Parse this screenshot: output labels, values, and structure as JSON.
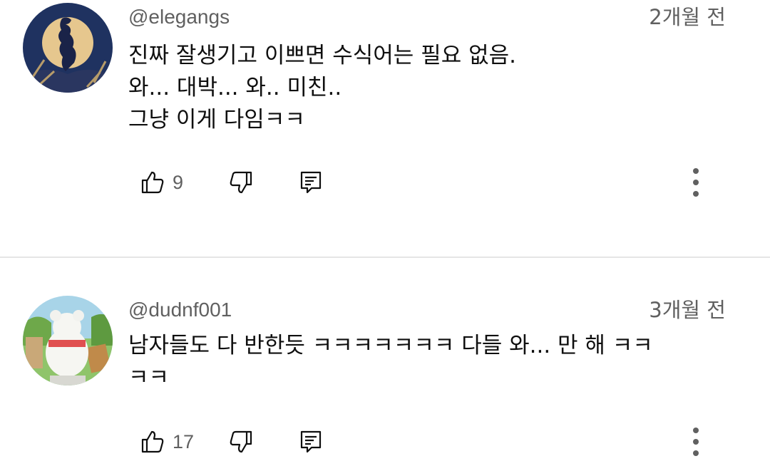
{
  "comments": [
    {
      "handle": "@elegangs",
      "time": "2개월 전",
      "lines": [
        "진짜 잘생기고 이쁘면 수식어는 필요 없음.",
        "와... 대박... 와.. 미친..",
        "그냥 이게 다임ㅋㅋ"
      ],
      "likes": "9",
      "avatar_icon": "silhouette-moon-avatar"
    },
    {
      "handle": "@dudnf001",
      "time": "3개월 전",
      "lines": [
        "남자들도 다 반한듯 ㅋㅋㅋㅋㅋㅋㅋ 다들 와... 만 해 ㅋㅋ",
        "ㅋㅋ"
      ],
      "likes": "17",
      "avatar_icon": "white-bear-avatar"
    }
  ],
  "icons": {
    "like": "thumbs-up-icon",
    "dislike": "thumbs-down-icon",
    "reply": "reply-icon",
    "more": "more-vertical-icon"
  },
  "colors": {
    "text": "#0f0f0f",
    "secondary": "#606060",
    "divider": "#e5e5e5",
    "avatar1_bg": "#1c2f5c",
    "avatar1_moon": "#e8c98d"
  }
}
